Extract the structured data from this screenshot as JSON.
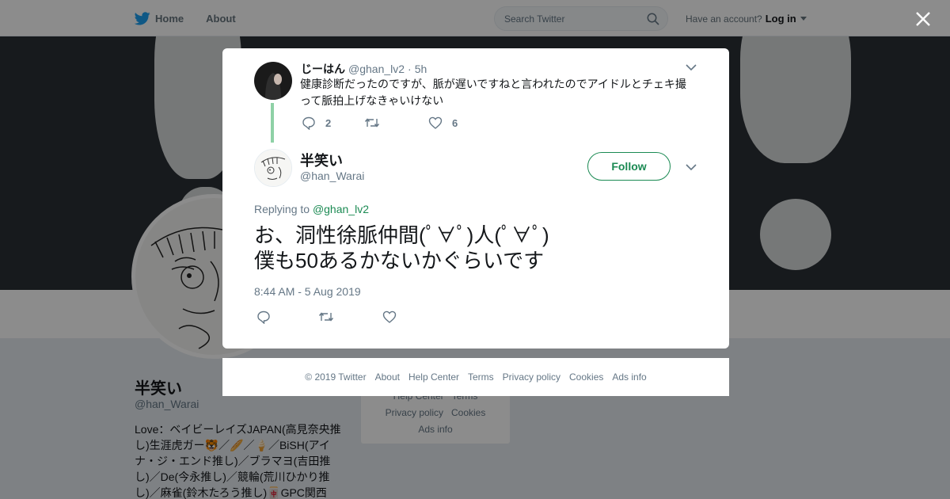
{
  "nav": {
    "home_label": "Home",
    "about_label": "About",
    "search_placeholder": "Search Twitter",
    "have_account_text": "Have an account?",
    "login_label": "Log in",
    "brand_color": "#1da1f2"
  },
  "background_profile": {
    "name": "半笑い",
    "handle": "@han_Warai",
    "bio": "Love：ベイビーレイズJAPAN(高見奈央推し)生涯虎ガー🐯／🥖／🍦／BiSH(アイナ・ジ・エンド推し)／ブラマヨ(吉田推し)／De(今永推し)／競輪(荒川ひかり推し)／麻雀(鈴木たろう推し)🀄GPC関西",
    "footer_links": [
      "Help Center",
      "Terms",
      "Privacy policy",
      "Cookies",
      "Ads info"
    ]
  },
  "parent_tweet": {
    "name": "じーはん",
    "handle": "@ghan_lv2",
    "separator": "·",
    "time": "5h",
    "text": "健康診断だったのですが、脈が遅いですねと言われたのでアイドルとチェキ撮って脈拍上げなきゃいけない",
    "reply_count": "2",
    "retweet_count": "",
    "like_count": "6"
  },
  "main_tweet": {
    "name": "半笑い",
    "handle": "@han_Warai",
    "follow_label": "Follow",
    "replying_prefix": "Replying to",
    "replying_to": "@ghan_lv2",
    "text": "お、洞性徐脈仲間(ﾟ∀ﾟ)人(ﾟ∀ﾟ)\n僕も50あるかないかぐらいです",
    "datetime": "8:44 AM - 5 Aug 2019",
    "accent_color": "#1b8a53"
  },
  "footer": {
    "copyright": "© 2019 Twitter",
    "links": [
      "About",
      "Help Center",
      "Terms",
      "Privacy policy",
      "Cookies",
      "Ads info"
    ]
  }
}
